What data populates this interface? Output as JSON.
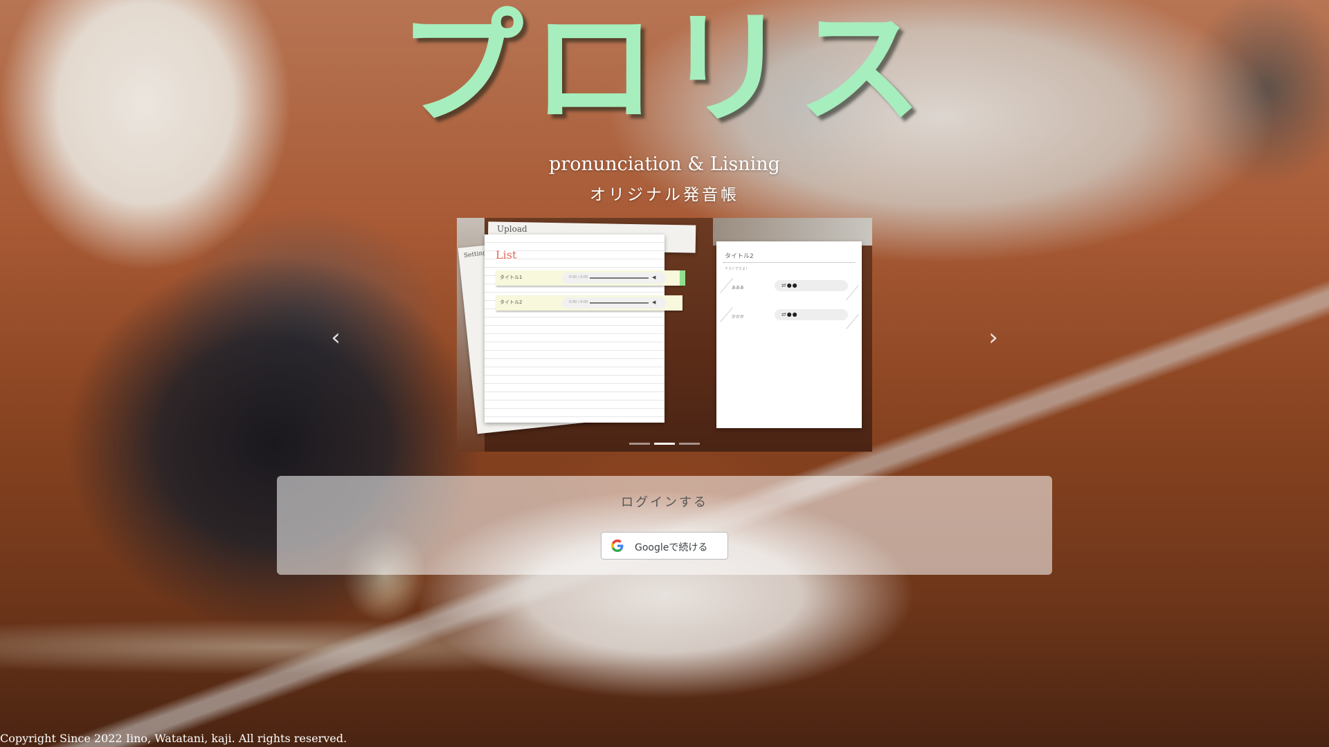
{
  "hero": {
    "title": "プロリス",
    "subtitle_en": "pronunciation & Lisning",
    "subtitle_jp": "オリジナル発音帳"
  },
  "carousel": {
    "prev_glyph": "‹",
    "next_glyph": "›",
    "indicator_count": 3,
    "active_indicator": 1,
    "slide": {
      "tab_upload": "Upload",
      "tab_setting": "Setting",
      "list_title": "List",
      "rows": [
        {
          "label": "タイトル1",
          "time": "0:00 / 0:00"
        },
        {
          "label": "タイトル2",
          "time": "0:00 / 0:00"
        }
      ],
      "detail_title": "タイトル2",
      "detail_sub": "テストですよ！",
      "detail_rows": [
        {
          "label": "あああ",
          "controls": "⇄●●"
        },
        {
          "label": "かかか",
          "controls": "⇄●●"
        }
      ]
    }
  },
  "login": {
    "heading": "ログインする",
    "google_button_label": "Googleで続ける"
  },
  "footer": {
    "copyright": "Copyright Since 2022 Iino, Watatani, kaji. All rights reserved."
  },
  "colors": {
    "title_green": "#a6eebd",
    "list_title_red": "#e06a5a",
    "row_highlight": "#f7f8dc",
    "accent_green": "#8fe08e"
  }
}
